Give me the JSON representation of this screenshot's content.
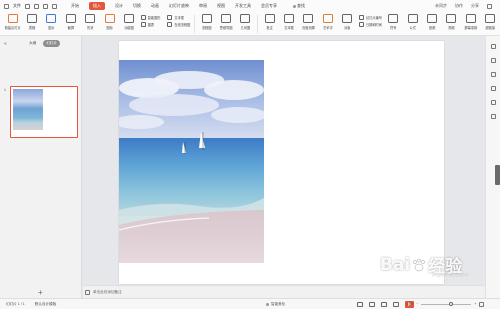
{
  "menubar": {
    "file_label": "文件",
    "tabs": [
      "开始",
      "插入",
      "设计",
      "切换",
      "动画",
      "幻灯片放映",
      "审阅",
      "视图",
      "开发工具",
      "会员专享"
    ],
    "active_tab": "插入",
    "search_label": "查找",
    "right_items": [
      "未同步",
      "协作",
      "分享"
    ]
  },
  "ribbon": {
    "buttons": [
      {
        "label": "新建幻灯片",
        "icon": "new-slide-icon"
      },
      {
        "label": "表格",
        "icon": "table-icon"
      },
      {
        "label": "图片",
        "icon": "image-icon"
      },
      {
        "label": "截屏",
        "icon": "screenshot-icon"
      },
      {
        "label": "形状",
        "icon": "shape-icon"
      },
      {
        "label": "图标",
        "icon": "icons-icon"
      },
      {
        "label": "功能图",
        "icon": "function-chart-icon"
      }
    ],
    "small_group_1": [
      "智能图形",
      "图表"
    ],
    "small_group_2": [
      "文本框",
      "在线流程图"
    ],
    "buttons2": [
      {
        "label": "流程图",
        "icon": "flowchart-icon"
      },
      {
        "label": "思维导图",
        "icon": "mindmap-icon"
      },
      {
        "label": "几何图",
        "icon": "geometry-icon"
      },
      {
        "label": "批注",
        "icon": "comment-icon"
      },
      {
        "label": "文本框",
        "icon": "textbox-icon"
      },
      {
        "label": "页眉页脚",
        "icon": "header-footer-icon"
      },
      {
        "label": "艺术字",
        "icon": "wordart-icon"
      },
      {
        "label": "对象",
        "icon": "object-icon"
      }
    ],
    "small_group_3": [
      "幻灯片编号",
      "日期和时间"
    ],
    "buttons3": [
      {
        "label": "符号",
        "icon": "symbol-icon"
      },
      {
        "label": "公式",
        "icon": "formula-icon"
      },
      {
        "label": "音频",
        "icon": "audio-icon"
      },
      {
        "label": "视频",
        "icon": "video-icon"
      },
      {
        "label": "屏幕录制",
        "icon": "screen-record-icon"
      },
      {
        "label": "超链接",
        "icon": "hyperlink-icon"
      }
    ]
  },
  "leftpanel": {
    "tab_outline": "大纲",
    "tab_slides": "幻灯片",
    "slide_number": "1",
    "add_label": "+"
  },
  "notes": {
    "placeholder": "单击此处添加备注"
  },
  "status": {
    "slide_info": "幻灯片 1 / 1",
    "theme": "默认设计模板",
    "beautify": "智能美化",
    "zoom": "45%"
  },
  "watermark": {
    "brand_left": "Bai",
    "brand_right": "经验",
    "sub": "jingyan.baidu.com"
  }
}
